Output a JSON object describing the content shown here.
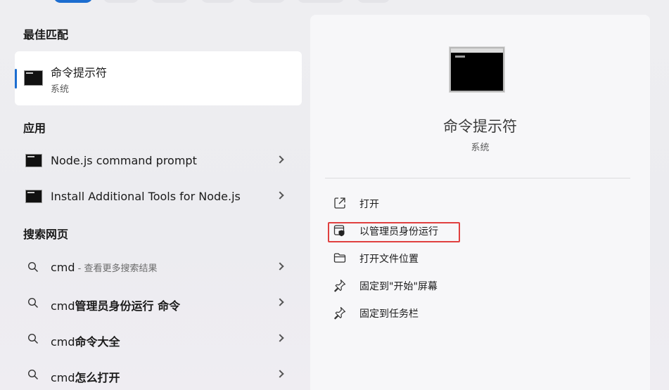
{
  "sections": {
    "best_match": "最佳匹配",
    "apps": "应用",
    "web": "搜索网页"
  },
  "best": {
    "title": "命令提示符",
    "sub": "系统"
  },
  "apps": [
    {
      "label": "Node.js command prompt"
    },
    {
      "label": "Install Additional Tools for Node.js"
    }
  ],
  "web": [
    {
      "query": "cmd",
      "suffix": " - 查看更多搜索结果",
      "bold": ""
    },
    {
      "query": "cmd",
      "suffix": "",
      "bold": "管理员身份运行 命令"
    },
    {
      "query": "cmd",
      "suffix": "",
      "bold": "命令大全"
    },
    {
      "query": "cmd",
      "suffix": "",
      "bold": "怎么打开"
    }
  ],
  "panel": {
    "title": "命令提示符",
    "sub": "系统",
    "actions": [
      {
        "label": "打开",
        "icon": "open-external-icon"
      },
      {
        "label": "以管理员身份运行",
        "icon": "shield-admin-icon"
      },
      {
        "label": "打开文件位置",
        "icon": "folder-icon"
      },
      {
        "label": "固定到\"开始\"屏幕",
        "icon": "pin-icon"
      },
      {
        "label": "固定到任务栏",
        "icon": "pin-icon"
      }
    ]
  },
  "colors": {
    "accent": "#1c6dd0",
    "highlight": "#e0403f"
  }
}
